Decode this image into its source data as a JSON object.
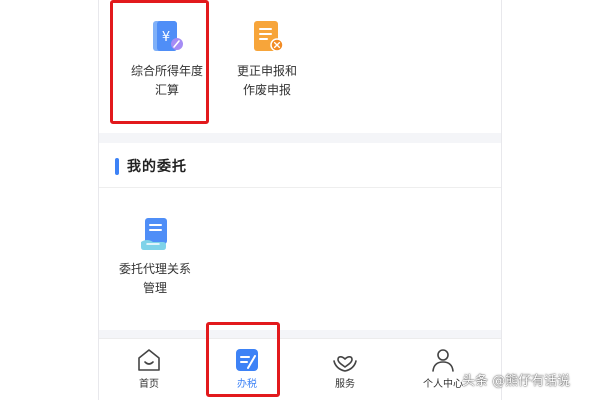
{
  "income_tax_section": {
    "items": [
      {
        "label": "综合所得年度\n汇算",
        "icon": "annual-settlement-icon"
      },
      {
        "label": "更正申报和\n作废申报",
        "icon": "correction-filing-icon"
      }
    ]
  },
  "delegation_section": {
    "title": "我的委托",
    "items": [
      {
        "label": "委托代理关系\n管理",
        "icon": "agent-relationship-icon"
      }
    ]
  },
  "bottom_nav": {
    "items": [
      {
        "label": "首页",
        "icon": "home-icon"
      },
      {
        "label": "办税",
        "icon": "tax-filing-icon",
        "active": true
      },
      {
        "label": "服务",
        "icon": "service-icon"
      },
      {
        "label": "个人中心",
        "icon": "user-icon"
      }
    ]
  },
  "watermark": "头条 @熊仔有话说",
  "colors": {
    "accent": "#3d82f6",
    "highlight": "#e2191c",
    "orange": "#f7a53a"
  }
}
